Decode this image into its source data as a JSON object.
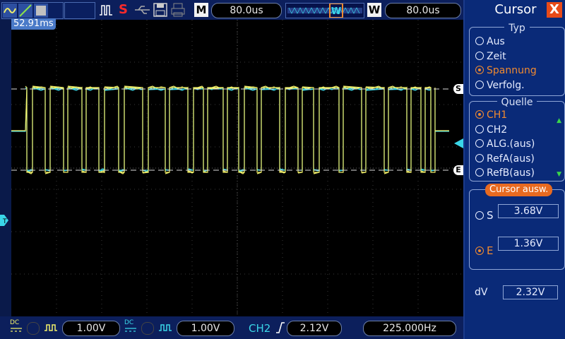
{
  "toolbar": {
    "timebase": "80.0us",
    "zoom_timebase": "80.0us",
    "stop_label": "S",
    "math_label": "M",
    "window_label": "W"
  },
  "scope": {
    "time_readout": "52.91ms",
    "cursor_s_marker": "S",
    "cursor_e_marker": "E"
  },
  "bottom": {
    "ch1_coupling": "DC",
    "ch1_scale": "1.00V",
    "ch2_coupling": "DC",
    "ch2_scale": "1.00V",
    "trigger_source": "CH2",
    "trigger_level": "2.12V",
    "frequency": "225.000Hz"
  },
  "panel": {
    "title": "Cursor",
    "close": "X",
    "type_group": "Typ",
    "type_options": [
      "Aus",
      "Zeit",
      "Spannung",
      "Verfolg."
    ],
    "type_selected": 2,
    "source_group": "Quelle",
    "source_options": [
      "CH1",
      "CH2",
      "ALG.(aus)",
      "RefA(aus)",
      "RefB(aus)"
    ],
    "source_selected": 0,
    "select_group": "Cursor  ausw.",
    "s_label": "S",
    "s_value": "3.68V",
    "e_label": "E",
    "e_value": "1.36V",
    "dv_label": "dV",
    "dv_value": "2.32V"
  },
  "colors": {
    "ch1": "#f2f06a",
    "ch2": "#3ad6e8",
    "accent": "#f08a30",
    "cursor_s": "#f2f06a"
  }
}
